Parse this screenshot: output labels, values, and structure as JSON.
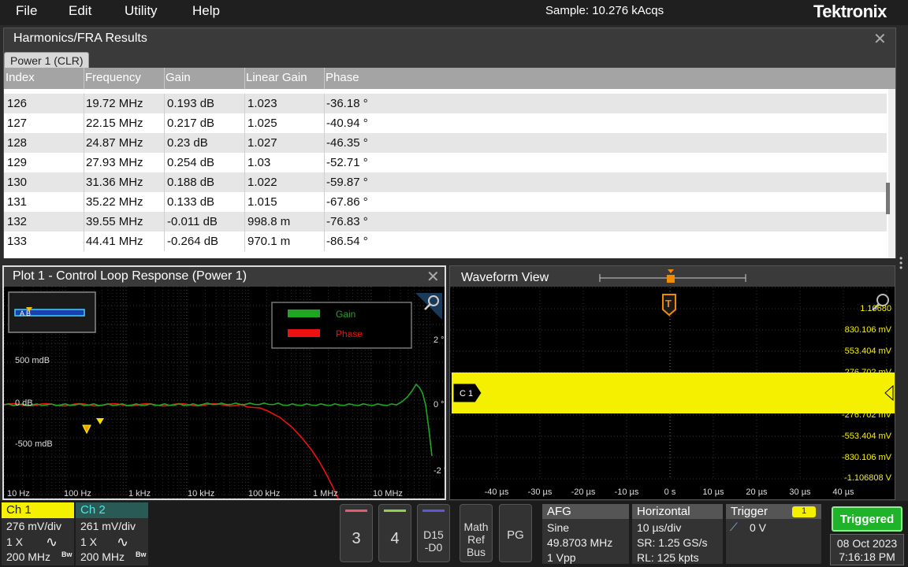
{
  "menu": {
    "items": [
      "File",
      "Edit",
      "Utility",
      "Help"
    ],
    "sample": "Sample: 10.276 kAcqs",
    "brand": "Tektronix"
  },
  "results": {
    "title": "Harmonics/FRA Results",
    "tab": "Power 1 (CLR)",
    "columns": [
      "Index",
      "Frequency",
      "Gain",
      "Linear Gain",
      "Phase"
    ],
    "rows": [
      [
        "126",
        "19.72 MHz",
        "0.193 dB",
        "1.023",
        "-36.18 °"
      ],
      [
        "127",
        "22.15 MHz",
        "0.217 dB",
        "1.025",
        "-40.94 °"
      ],
      [
        "128",
        "24.87 MHz",
        "0.23 dB",
        "1.027",
        "-46.35 °"
      ],
      [
        "129",
        "27.93 MHz",
        "0.254 dB",
        "1.03",
        "-52.71 °"
      ],
      [
        "130",
        "31.36 MHz",
        "0.188 dB",
        "1.022",
        "-59.87 °"
      ],
      [
        "131",
        "35.22 MHz",
        "0.133 dB",
        "1.015",
        "-67.86 °"
      ],
      [
        "132",
        "39.55 MHz",
        "-0.011 dB",
        "998.8 m",
        "-76.83 °"
      ],
      [
        "133",
        "44.41 MHz",
        "-0.264 dB",
        "970.1 m",
        "-86.54 °"
      ]
    ]
  },
  "plot": {
    "title": "Plot 1 - Control Loop Response (Power 1)",
    "legend": [
      "Gain",
      "Phase"
    ],
    "y_labels": [
      "500 mdB",
      "0 dB",
      "-500 mdB"
    ],
    "y2_labels": [
      "2 °",
      "0 °",
      "-2 °"
    ],
    "x_labels": [
      "10 Hz",
      "100 Hz",
      "1 kHz",
      "10 kHz",
      "100 kHz",
      "1 MHz",
      "10 MHz"
    ],
    "marker_label": "A B",
    "gain_color": "#1fa81f",
    "phase_color": "#ee1111"
  },
  "waveform": {
    "title": "Waveform View",
    "trigger_marker": "T",
    "channel_marker": "C 1",
    "y_labels": [
      "1.10680",
      "830.106 mV",
      "553.404 mV",
      "276.702 mV",
      "-276.702 mV",
      "-553.404 mV",
      "-830.106 mV",
      "-1.106808 V"
    ],
    "x_labels": [
      "-40 µs",
      "-30 µs",
      "-20 µs",
      "-10 µs",
      "0 s",
      "10 µs",
      "20 µs",
      "30 µs",
      "40 µs"
    ],
    "trace_color": "#f5f000"
  },
  "channels": [
    {
      "name": "Ch 1",
      "scale": "276 mV/div",
      "probe": "1 X",
      "bw": "200 MHz",
      "color": "#f5f000",
      "head_text": "#222"
    },
    {
      "name": "Ch 2",
      "scale": "261 mV/div",
      "probe": "1 X",
      "bw": "200 MHz",
      "color": "#2a5a55",
      "head_text": "#4ee6e6"
    }
  ],
  "buttons": [
    {
      "label": "3",
      "color": "#e85a6a"
    },
    {
      "label": "4",
      "color": "#8fd14f"
    },
    {
      "label": "D15\n-D0",
      "color": "#5a5ad8"
    }
  ],
  "math_button": "Math Ref Bus",
  "pg_button": "PG",
  "afg": {
    "title": "AFG",
    "wave": "Sine",
    "freq": "49.8703 MHz",
    "amp": "1 Vpp"
  },
  "horizontal": {
    "title": "Horizontal",
    "scale": "10 µs/div",
    "sr": "SR: 1.25 GS/s",
    "rl": "RL: 125 kpts"
  },
  "trigger": {
    "title": "Trigger",
    "channel": "1",
    "level": "0 V"
  },
  "status": "Triggered",
  "date": "08 Oct 2023",
  "time": "7:16:18 PM"
}
